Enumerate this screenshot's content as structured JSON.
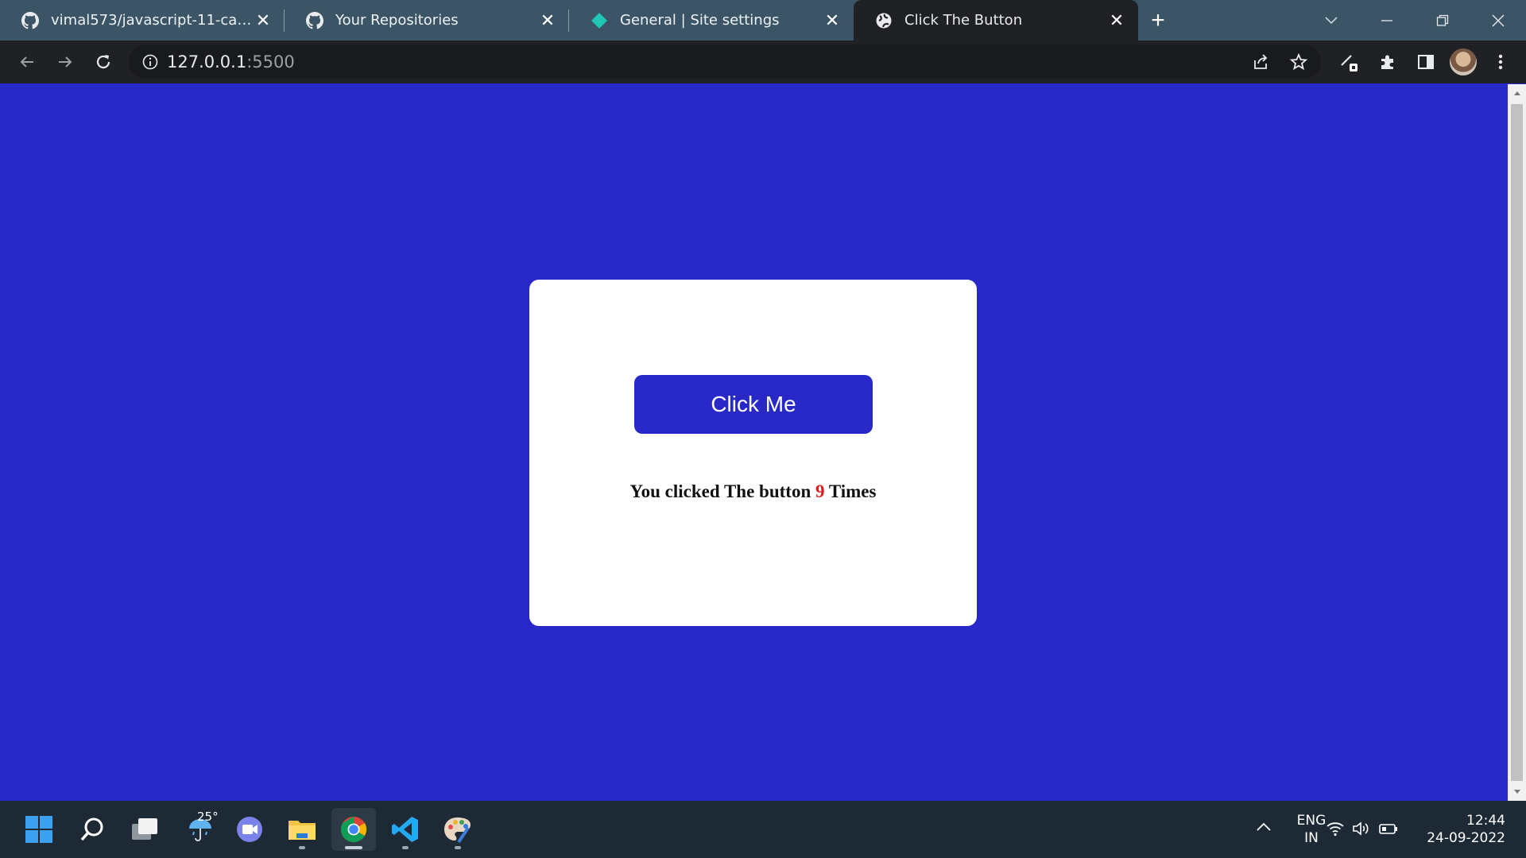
{
  "browser": {
    "tabs": [
      {
        "title": "vimal573/javascript-11-calculator",
        "icon": "github-icon",
        "active": false
      },
      {
        "title": "Your Repositories",
        "icon": "github-icon",
        "active": false
      },
      {
        "title": "General | Site settings",
        "icon": "diamond-icon",
        "active": false
      },
      {
        "title": "Click The Button",
        "icon": "globe-icon",
        "active": true
      }
    ],
    "address": {
      "host": "127.0.0.1",
      "port": ":5500"
    }
  },
  "page": {
    "button_label": "Click Me",
    "result_prefix": "You clicked The button ",
    "click_count": "9",
    "result_suffix": " Times",
    "background_color": "#2828c9",
    "count_color": "#e0191e"
  },
  "taskbar": {
    "weather_temp": "25°",
    "language": "ENG",
    "region": "IN",
    "time": "12:44",
    "date": "24-09-2022"
  }
}
